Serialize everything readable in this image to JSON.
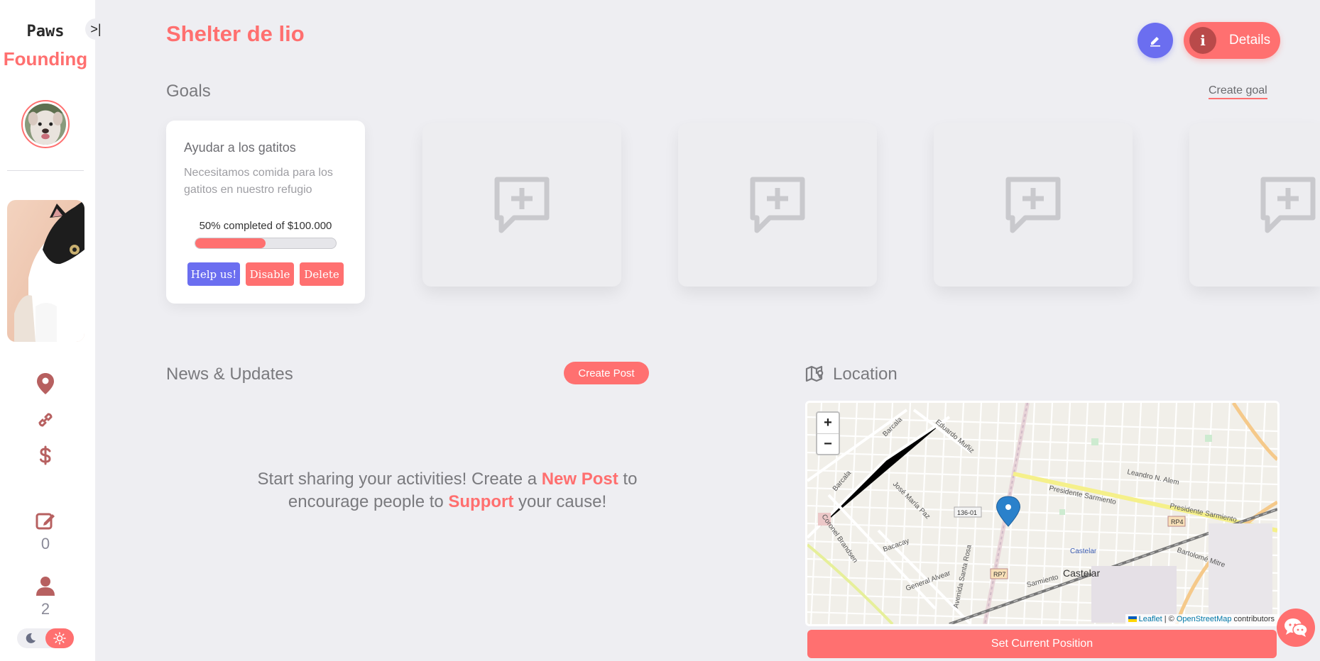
{
  "sidebar": {
    "brand_line1": "Paws",
    "brand_line2": "Founding",
    "collapse_label": ">|",
    "posts_count": "0",
    "followers_count": "2",
    "icons": [
      "location-pin-icon",
      "link-icon",
      "dollar-icon",
      "edit-icon",
      "user-icon"
    ]
  },
  "header": {
    "title": "Shelter de lio",
    "details_label": "Details",
    "details_icon": "i"
  },
  "goals": {
    "section_title": "Goals",
    "create_label": "Create goal",
    "items": [
      {
        "title": "Ayudar a los gatitos",
        "description": "Necesitamos comida para los gatitos en nuestro refugio",
        "progress_text": "50% completed of $100.000",
        "progress_fraction": 0.5,
        "help_label": "Help us!",
        "disable_label": "Disable",
        "delete_label": "Delete"
      }
    ],
    "placeholder_count": 4
  },
  "news": {
    "section_title": "News & Updates",
    "create_label": "Create Post",
    "empty_part1": "Start sharing your activities! Create a ",
    "empty_highlight1": "New Post",
    "empty_part2": " to encourage people to ",
    "empty_highlight2": "Support",
    "empty_part3": " your cause!"
  },
  "location": {
    "section_title": "Location",
    "zoom_in": "+",
    "zoom_out": "−",
    "attribution_leaflet": "Leaflet",
    "attribution_sep": " | © ",
    "attribution_osm": "OpenStreetMap",
    "attribution_tail": " contributors",
    "set_position_label": "Set Current Position",
    "map_labels": {
      "barcala_1": "Barcala",
      "barcala_2": "Barcala",
      "eduardo": "Eduardo Muñiz",
      "leandro": "Leandro N. Alem",
      "pres_1": "Presidente Sarmiento",
      "pres_2": "Presidente Sarmiento",
      "jose": "José María Paz",
      "coronel": "Coronel Brandsen",
      "bacacay": "Bacacay",
      "route_136": "136-01",
      "rp4": "RP4",
      "rp7": "RP7",
      "castelar_station": "Castelar",
      "castelar": "Castelar",
      "bartolome": "Bartolomé Mitre",
      "general": "General Alvear",
      "avenida": "Avenida Santa Rosa",
      "sarmiento_low": "Sarmiento"
    }
  },
  "colors": {
    "accent": "#ff6f6f",
    "primary": "#6b6ef0",
    "background": "#eeeef2",
    "map_marker": "#2a81cb"
  }
}
